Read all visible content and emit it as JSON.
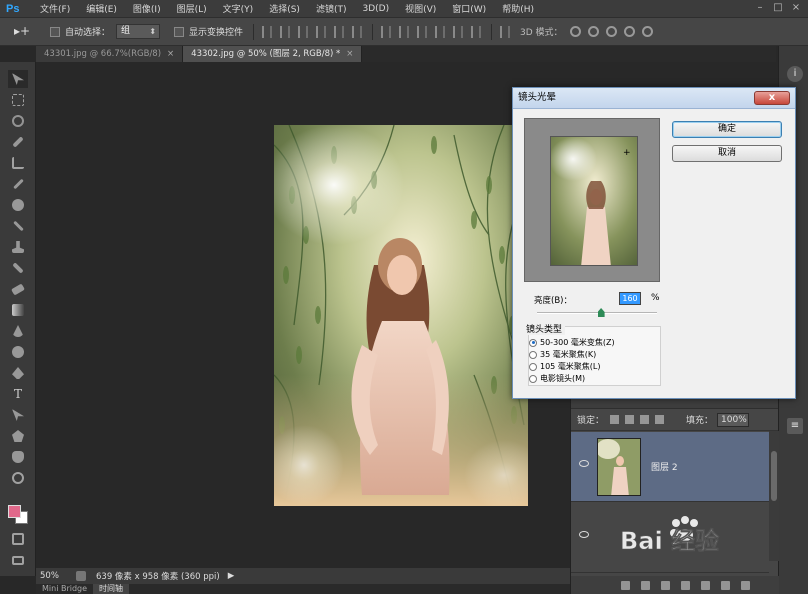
{
  "app": {
    "logo": "Ps"
  },
  "menu": [
    "文件(F)",
    "编辑(E)",
    "图像(I)",
    "图层(L)",
    "文字(Y)",
    "选择(S)",
    "滤镜(T)",
    "3D(D)",
    "视图(V)",
    "窗口(W)",
    "帮助(H)"
  ],
  "options": {
    "auto_select_label": "自动选择：",
    "auto_select_value": "组",
    "show_transform_label": "显示变换控件",
    "mode3d_label": "3D 模式："
  },
  "tabs": [
    {
      "label": "43301.jpg @ 66.7%(RGB/8)",
      "close": "×"
    },
    {
      "label": "43302.jpg @ 50% (图层 2, RGB/8) *",
      "close": "×"
    }
  ],
  "status": {
    "zoom": "50%",
    "doc_info": "639 像素 x 958 像素 (360 ppi)",
    "arrow": "▶"
  },
  "bottom_tabs": [
    "Mini Bridge",
    "时间轴"
  ],
  "layers": {
    "lock_label": "锁定：",
    "fill_label": "填充：",
    "fill_value": "100%",
    "layer_name": "图层 2"
  },
  "dialog": {
    "title": "镜头光晕",
    "close": "x",
    "ok": "确定",
    "cancel": "取消",
    "brightness_label": "亮度(B)：",
    "brightness_value": "160",
    "brightness_percent_sign": "%",
    "brightness_level": 0.53,
    "lens_type_label": "镜头类型",
    "lens_options": [
      {
        "label": "50-300 毫米变焦(Z)",
        "selected": true
      },
      {
        "label": "35 毫米聚焦(K)",
        "selected": false
      },
      {
        "label": "105 毫米聚焦(L)",
        "selected": false
      },
      {
        "label": "电影镜头(M)",
        "selected": false
      }
    ]
  },
  "watermark": {
    "text": "Bai 经验"
  },
  "colors": {
    "foreground": "#e0688a",
    "background": "#ffffff",
    "selected_layer": "#5d6b85",
    "ps_blue": "#31a8ff"
  }
}
